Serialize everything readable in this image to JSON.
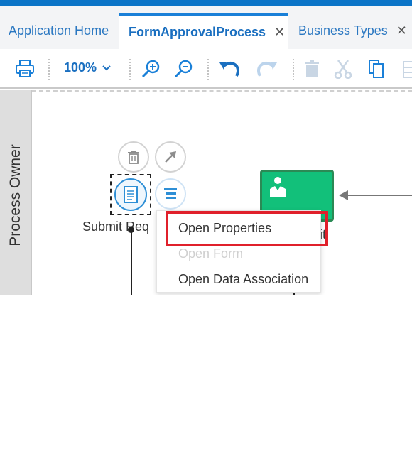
{
  "tabs": [
    {
      "label": "Application Home"
    },
    {
      "label": "FormApprovalProcess",
      "close": "✕"
    },
    {
      "label": "Business Types",
      "close": "✕"
    }
  ],
  "toolbar": {
    "zoom_label": "100%"
  },
  "lane": {
    "label": "Process Owner"
  },
  "task": {
    "label": "Submit Req"
  },
  "behind_text": "it",
  "context_menu": {
    "items": [
      {
        "label": "Open Properties",
        "enabled": true
      },
      {
        "label": "Open Form",
        "enabled": false
      },
      {
        "label": "Open Data Association",
        "enabled": true
      }
    ]
  },
  "colors": {
    "brand_blue": "#0b74c7",
    "task_green": "#12c07a",
    "highlight_red": "#e0202b"
  }
}
